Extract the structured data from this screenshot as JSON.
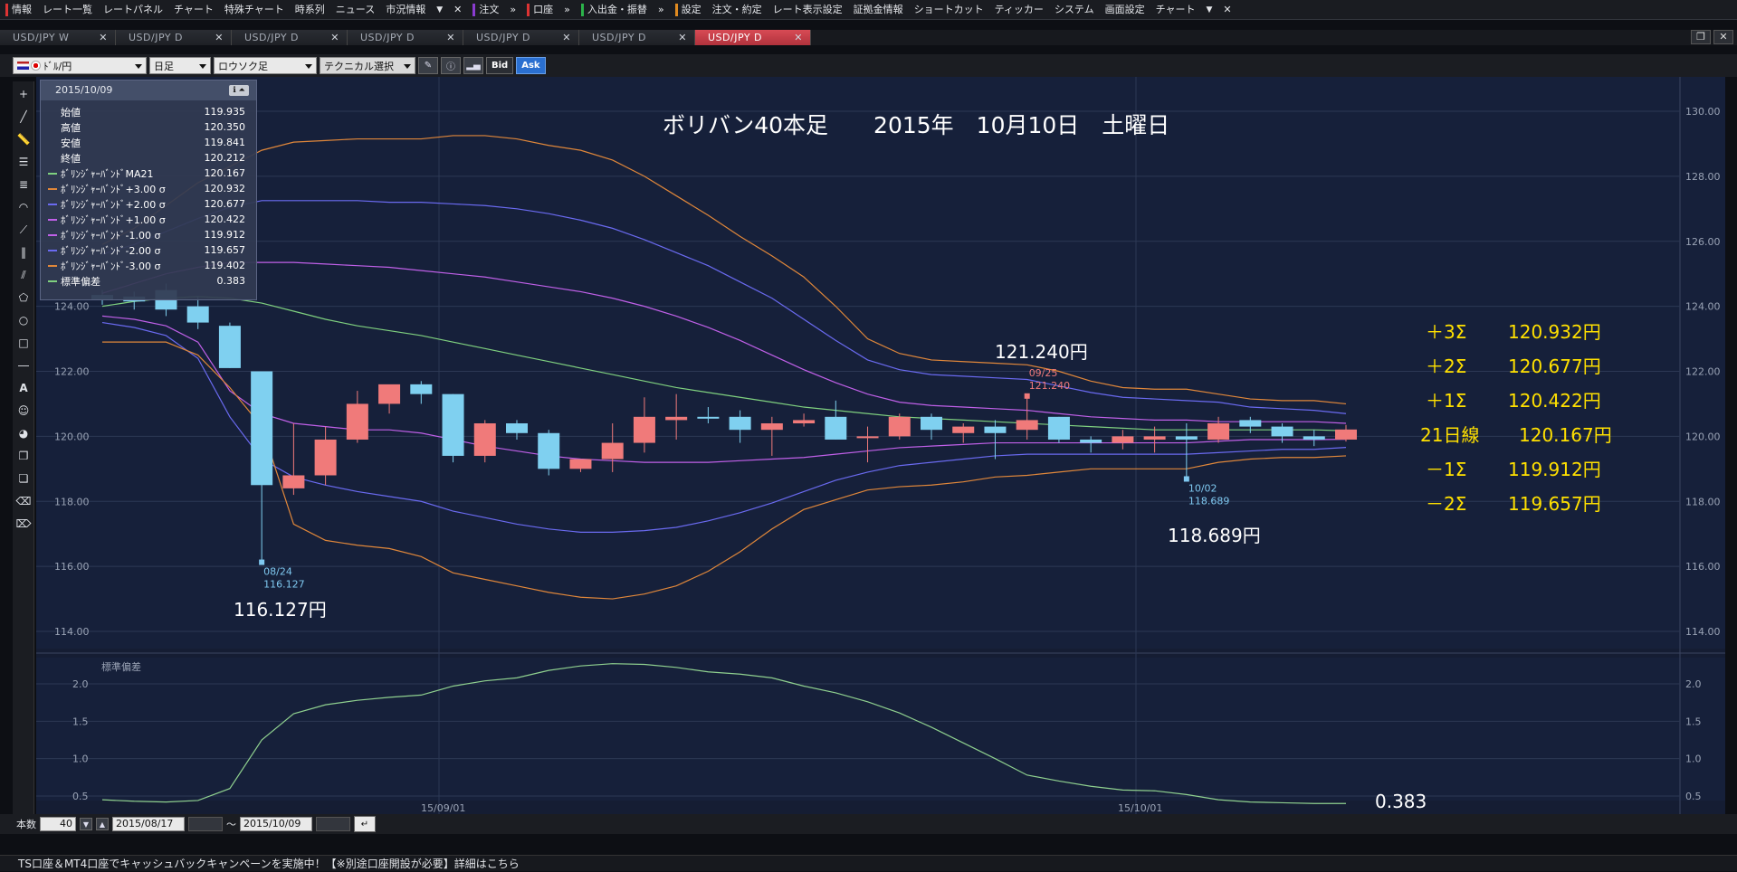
{
  "menubar": {
    "items": [
      "情報",
      "レート一覧",
      "レートパネル",
      "チャート",
      "特殊チャート",
      "時系列",
      "ニュース",
      "市況情報"
    ],
    "items2": [
      "注文"
    ],
    "items3": [
      "口座"
    ],
    "items4": [
      "入出金・振替"
    ],
    "items5": [
      "設定",
      "注文・約定",
      "レート表示設定",
      "証拠金情報",
      "ショートカット",
      "ティッカー",
      "システム",
      "画面設定",
      "チャート"
    ],
    "close_glyph": "✕",
    "dropdown_glyph": "▼",
    "more_glyph": "»"
  },
  "tabs": [
    {
      "label": "USD/JPY W",
      "active": false
    },
    {
      "label": "USD/JPY D",
      "active": false
    },
    {
      "label": "USD/JPY D",
      "active": false
    },
    {
      "label": "USD/JPY D",
      "active": false
    },
    {
      "label": "USD/JPY D",
      "active": false
    },
    {
      "label": "USD/JPY D",
      "active": false
    },
    {
      "label": "USD/JPY D",
      "active": true
    }
  ],
  "toolbar": {
    "pair": "ﾄﾞﾙ/円",
    "period": "日足",
    "chart_type": "ロウソク足",
    "technical": "テクニカル選択",
    "bid": "Bid",
    "ask": "Ask"
  },
  "info_panel": {
    "date": "2015/10/09",
    "rows": [
      {
        "label": "始値",
        "value": "119.935",
        "color": ""
      },
      {
        "label": "高値",
        "value": "120.350",
        "color": ""
      },
      {
        "label": "安値",
        "value": "119.841",
        "color": ""
      },
      {
        "label": "終値",
        "value": "120.212",
        "color": ""
      },
      {
        "label": "ﾎﾞﾘﾝｼﾞｬｰﾊﾞﾝﾄﾞMA21",
        "value": "120.167",
        "color": "#7fd07f"
      },
      {
        "label": "ﾎﾞﾘﾝｼﾞｬｰﾊﾞﾝﾄﾞ+3.00 σ",
        "value": "120.932",
        "color": "#e0873a"
      },
      {
        "label": "ﾎﾞﾘﾝｼﾞｬｰﾊﾞﾝﾄﾞ+2.00 σ",
        "value": "120.677",
        "color": "#6a6af0"
      },
      {
        "label": "ﾎﾞﾘﾝｼﾞｬｰﾊﾞﾝﾄﾞ+1.00 σ",
        "value": "120.422",
        "color": "#c060e8"
      },
      {
        "label": "ﾎﾞﾘﾝｼﾞｬｰﾊﾞﾝﾄﾞ-1.00 σ",
        "value": "119.912",
        "color": "#c060e8"
      },
      {
        "label": "ﾎﾞﾘﾝｼﾞｬｰﾊﾞﾝﾄﾞ-2.00 σ",
        "value": "119.657",
        "color": "#6a6af0"
      },
      {
        "label": "ﾎﾞﾘﾝｼﾞｬｰﾊﾞﾝﾄﾞ-3.00 σ",
        "value": "119.402",
        "color": "#e0873a"
      },
      {
        "label": "標準偏差",
        "value": "0.383",
        "color": "#7fd07f"
      }
    ]
  },
  "annotations": {
    "title": "ボリバン40本足　　2015年　10月10日　土曜日",
    "high_price": "121.240円",
    "low_price_left": "116.127円",
    "low_price_right": "118.689円",
    "stddev_value": "0.383",
    "marker_high_date": "09/25",
    "marker_high_value": "121.240",
    "marker_low_left_date": "08/24",
    "marker_low_left_value": "116.127",
    "marker_low_right_date": "10/02",
    "marker_low_right_value": "118.689",
    "bands": [
      {
        "label": "＋3Σ",
        "value": "120.932円"
      },
      {
        "label": "＋2Σ",
        "value": "120.677円"
      },
      {
        "label": "＋1Σ",
        "value": "120.422円"
      },
      {
        "label": "21日線",
        "value": "120.167円"
      },
      {
        "label": "－1Σ",
        "value": "119.912円"
      },
      {
        "label": "－2Σ",
        "value": "119.657円"
      }
    ],
    "annotation_color": "#ffe000"
  },
  "chart_data": {
    "type": "candlestick",
    "price_axis": {
      "ticks": [
        "130.00",
        "128.00",
        "126.00",
        "124.00",
        "122.00",
        "120.00",
        "118.00",
        "116.00",
        "114.00"
      ],
      "range": [
        113.5,
        131.0
      ]
    },
    "x_labels": [
      "15/09/01",
      "15/10/01"
    ],
    "sub_title": "標準偏差",
    "sub_axis": {
      "ticks": [
        "2.0",
        "1.5",
        "1.0",
        "0.5"
      ],
      "range": [
        0.3,
        2.4
      ]
    },
    "candles": [
      {
        "o": 124.35,
        "h": 124.5,
        "l": 124.05,
        "c": 124.2
      },
      {
        "o": 124.3,
        "h": 124.45,
        "l": 123.9,
        "c": 124.15
      },
      {
        "o": 124.5,
        "h": 124.7,
        "l": 123.7,
        "c": 123.9
      },
      {
        "o": 124.0,
        "h": 124.3,
        "l": 123.3,
        "c": 123.5
      },
      {
        "o": 123.4,
        "h": 123.5,
        "l": 122.1,
        "c": 122.1
      },
      {
        "o": 122.0,
        "h": 122.0,
        "l": 116.127,
        "c": 118.5
      },
      {
        "o": 118.4,
        "h": 120.4,
        "l": 118.2,
        "c": 118.8
      },
      {
        "o": 118.8,
        "h": 120.3,
        "l": 118.5,
        "c": 119.9
      },
      {
        "o": 119.9,
        "h": 121.4,
        "l": 119.8,
        "c": 121.0
      },
      {
        "o": 121.0,
        "h": 121.5,
        "l": 120.7,
        "c": 121.6
      },
      {
        "o": 121.6,
        "h": 121.7,
        "l": 121.0,
        "c": 121.3
      },
      {
        "o": 121.3,
        "h": 121.3,
        "l": 119.2,
        "c": 119.4
      },
      {
        "o": 119.4,
        "h": 120.5,
        "l": 119.2,
        "c": 120.4
      },
      {
        "o": 120.4,
        "h": 120.5,
        "l": 119.9,
        "c": 120.1
      },
      {
        "o": 120.1,
        "h": 120.2,
        "l": 118.8,
        "c": 119.0
      },
      {
        "o": 119.0,
        "h": 119.3,
        "l": 118.9,
        "c": 119.3
      },
      {
        "o": 119.3,
        "h": 120.4,
        "l": 118.9,
        "c": 119.8
      },
      {
        "o": 119.8,
        "h": 121.2,
        "l": 119.5,
        "c": 120.6
      },
      {
        "o": 120.5,
        "h": 121.3,
        "l": 119.9,
        "c": 120.6
      },
      {
        "o": 120.6,
        "h": 120.9,
        "l": 120.4,
        "c": 120.55
      },
      {
        "o": 120.6,
        "h": 120.8,
        "l": 119.8,
        "c": 120.2
      },
      {
        "o": 120.2,
        "h": 120.6,
        "l": 119.4,
        "c": 120.4
      },
      {
        "o": 120.4,
        "h": 120.7,
        "l": 120.3,
        "c": 120.5
      },
      {
        "o": 120.6,
        "h": 121.1,
        "l": 119.9,
        "c": 119.9
      },
      {
        "o": 120.0,
        "h": 120.3,
        "l": 119.2,
        "c": 120.0
      },
      {
        "o": 120.0,
        "h": 120.7,
        "l": 119.9,
        "c": 120.6
      },
      {
        "o": 120.6,
        "h": 120.7,
        "l": 119.9,
        "c": 120.2
      },
      {
        "o": 120.1,
        "h": 120.4,
        "l": 119.8,
        "c": 120.3
      },
      {
        "o": 120.3,
        "h": 120.5,
        "l": 119.3,
        "c": 120.1
      },
      {
        "o": 120.2,
        "h": 121.24,
        "l": 119.9,
        "c": 120.5
      },
      {
        "o": 120.6,
        "h": 120.6,
        "l": 119.8,
        "c": 119.9
      },
      {
        "o": 119.9,
        "h": 120.0,
        "l": 119.5,
        "c": 119.8
      },
      {
        "o": 119.8,
        "h": 120.2,
        "l": 119.6,
        "c": 120.0
      },
      {
        "o": 119.9,
        "h": 120.3,
        "l": 119.5,
        "c": 120.0
      },
      {
        "o": 120.0,
        "h": 120.4,
        "l": 118.689,
        "c": 119.9
      },
      {
        "o": 119.9,
        "h": 120.6,
        "l": 119.8,
        "c": 120.4
      },
      {
        "o": 120.5,
        "h": 120.6,
        "l": 120.1,
        "c": 120.3
      },
      {
        "o": 120.3,
        "h": 120.4,
        "l": 119.8,
        "c": 120.0
      },
      {
        "o": 120.0,
        "h": 120.2,
        "l": 119.7,
        "c": 119.9
      },
      {
        "o": 119.9,
        "h": 120.35,
        "l": 119.84,
        "c": 120.21
      }
    ],
    "series": [
      {
        "name": "ﾎﾞﾘﾝｼﾞｬｰﾊﾞﾝﾄﾞ+3.00 σ",
        "color": "#e0873a",
        "values": [
          125.9,
          126.4,
          127.1,
          127.8,
          128.3,
          128.8,
          129.05,
          129.1,
          129.15,
          129.15,
          129.15,
          129.25,
          129.25,
          129.15,
          128.95,
          128.8,
          128.5,
          128.0,
          127.4,
          126.8,
          126.15,
          125.55,
          124.9,
          124.0,
          123.0,
          122.55,
          122.35,
          122.3,
          122.25,
          122.2,
          122.0,
          121.7,
          121.5,
          121.45,
          121.45,
          121.3,
          121.15,
          121.1,
          121.1,
          121.0
        ]
      },
      {
        "name": "ﾎﾞﾘﾝｼﾞｬｰﾊﾞﾝﾄﾞ+2.00 σ",
        "color": "#6a6af0",
        "values": [
          125.6,
          125.9,
          126.3,
          126.7,
          127.05,
          127.25,
          127.25,
          127.25,
          127.25,
          127.2,
          127.2,
          127.15,
          127.1,
          127.0,
          126.85,
          126.65,
          126.4,
          126.05,
          125.65,
          125.25,
          124.75,
          124.25,
          123.6,
          122.95,
          122.35,
          122.05,
          121.9,
          121.85,
          121.8,
          121.75,
          121.55,
          121.35,
          121.2,
          121.15,
          121.1,
          121.05,
          120.9,
          120.85,
          120.8,
          120.7
        ]
      },
      {
        "name": "ﾎﾞﾘﾝｼﾞｬｰﾊﾞﾝﾄﾞ+1.00 σ",
        "color": "#c060e8",
        "values": [
          124.4,
          124.7,
          125.0,
          125.2,
          125.35,
          125.35,
          125.35,
          125.3,
          125.25,
          125.2,
          125.1,
          125.0,
          124.9,
          124.75,
          124.6,
          124.45,
          124.25,
          124.0,
          123.7,
          123.35,
          122.95,
          122.5,
          122.05,
          121.65,
          121.3,
          121.05,
          120.95,
          120.9,
          120.85,
          120.8,
          120.7,
          120.6,
          120.55,
          120.5,
          120.5,
          120.45,
          120.45,
          120.45,
          120.45,
          120.4
        ]
      },
      {
        "name": "ﾎﾞﾘﾝｼﾞｬｰﾊﾞﾝﾄﾞMA21",
        "color": "#7fd07f",
        "values": [
          124.0,
          124.15,
          124.25,
          124.3,
          124.25,
          124.1,
          123.85,
          123.6,
          123.4,
          123.25,
          123.1,
          122.9,
          122.7,
          122.5,
          122.3,
          122.1,
          121.9,
          121.7,
          121.5,
          121.35,
          121.2,
          121.05,
          120.9,
          120.8,
          120.7,
          120.6,
          120.55,
          120.5,
          120.45,
          120.4,
          120.35,
          120.3,
          120.25,
          120.2,
          120.2,
          120.2,
          120.2,
          120.2,
          120.2,
          120.17
        ]
      },
      {
        "name": "ﾎﾞﾘﾝｼﾞｬｰﾊﾞﾝﾄﾞ-1.00 σ",
        "color": "#c060e8",
        "values": [
          123.7,
          123.6,
          123.4,
          122.9,
          121.4,
          120.7,
          120.4,
          120.3,
          120.2,
          120.2,
          120.1,
          119.9,
          119.7,
          119.55,
          119.4,
          119.3,
          119.25,
          119.2,
          119.2,
          119.2,
          119.25,
          119.3,
          119.35,
          119.45,
          119.55,
          119.65,
          119.7,
          119.75,
          119.8,
          119.8,
          119.8,
          119.8,
          119.8,
          119.8,
          119.8,
          119.85,
          119.9,
          119.9,
          119.9,
          119.91
        ]
      },
      {
        "name": "ﾎﾞﾘﾝｼﾞｬｰﾊﾞﾝﾄﾞ-2.00 σ",
        "color": "#6a6af0",
        "values": [
          123.5,
          123.35,
          123.1,
          122.4,
          120.6,
          119.3,
          118.75,
          118.5,
          118.3,
          118.15,
          118.0,
          117.7,
          117.5,
          117.3,
          117.15,
          117.05,
          117.05,
          117.1,
          117.2,
          117.4,
          117.65,
          117.95,
          118.3,
          118.65,
          118.9,
          119.1,
          119.2,
          119.3,
          119.4,
          119.45,
          119.45,
          119.45,
          119.45,
          119.45,
          119.45,
          119.5,
          119.55,
          119.6,
          119.6,
          119.66
        ]
      },
      {
        "name": "ﾎﾞﾘﾝｼﾞｬｰﾊﾞﾝﾄﾞ-3.00 σ",
        "color": "#e0873a",
        "values": [
          122.9,
          122.9,
          122.9,
          122.5,
          121.5,
          120.3,
          117.3,
          116.8,
          116.65,
          116.55,
          116.3,
          115.8,
          115.6,
          115.4,
          115.2,
          115.05,
          115.0,
          115.15,
          115.4,
          115.85,
          116.45,
          117.15,
          117.75,
          118.05,
          118.35,
          118.45,
          118.5,
          118.6,
          118.75,
          118.8,
          118.9,
          119.0,
          119.0,
          119.0,
          119.0,
          119.2,
          119.3,
          119.35,
          119.35,
          119.4
        ]
      }
    ],
    "stddev": [
      0.45,
      0.43,
      0.42,
      0.44,
      0.6,
      1.25,
      1.6,
      1.72,
      1.78,
      1.82,
      1.85,
      1.97,
      2.04,
      2.08,
      2.18,
      2.24,
      2.27,
      2.26,
      2.22,
      2.16,
      2.13,
      2.08,
      1.97,
      1.88,
      1.76,
      1.61,
      1.42,
      1.21,
      1.0,
      0.78,
      0.7,
      0.63,
      0.58,
      0.57,
      0.52,
      0.45,
      0.42,
      0.41,
      0.4,
      0.4
    ]
  },
  "bottombar": {
    "count_label": "本数",
    "count_value": "40",
    "from_date": "2015/08/17",
    "tilde": "～",
    "to_date": "2015/10/09"
  },
  "statusbar": {
    "text": "TS口座＆MT4口座でキャッシュバックキャンペーンを実施中！【※別途口座開設が必要】詳細はこちら"
  }
}
